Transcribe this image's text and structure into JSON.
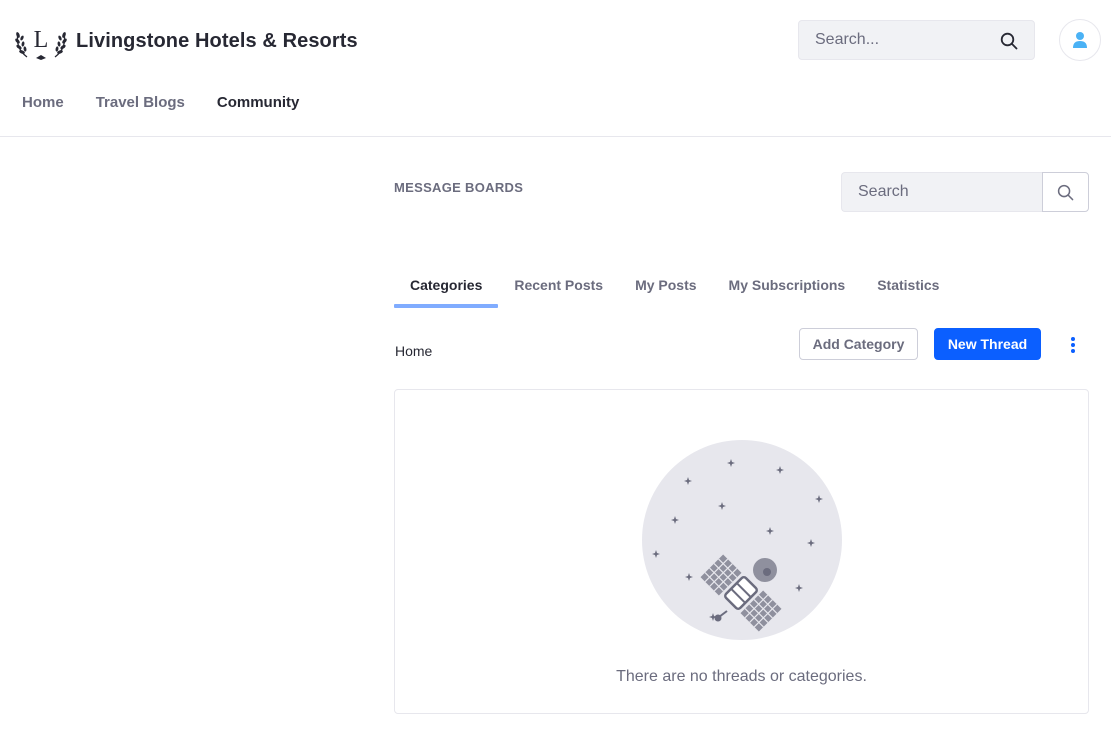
{
  "site": {
    "name": "Livingstone Hotels & Resorts",
    "logo_icon": "laurel-L-logo-icon"
  },
  "header_search": {
    "placeholder": "Search...",
    "icon": "search-icon"
  },
  "user": {
    "icon": "user-avatar-icon"
  },
  "nav": {
    "items": [
      {
        "label": "Home",
        "active": false
      },
      {
        "label": "Travel Blogs",
        "active": false
      },
      {
        "label": "Community",
        "active": true
      }
    ]
  },
  "portlet": {
    "title": "MESSAGE BOARDS",
    "search": {
      "placeholder": "Search",
      "icon": "search-icon"
    },
    "tabs": [
      {
        "label": "Categories",
        "active": true
      },
      {
        "label": "Recent Posts",
        "active": false
      },
      {
        "label": "My Posts",
        "active": false
      },
      {
        "label": "My Subscriptions",
        "active": false
      },
      {
        "label": "Statistics",
        "active": false
      }
    ],
    "breadcrumb": "Home",
    "add_category_label": "Add Category",
    "new_thread_label": "New Thread",
    "options_icon": "vertical-ellipsis-icon",
    "empty_state": {
      "message": "There are no threads or categories.",
      "illustration": "satellite-in-space-illustration"
    }
  },
  "colors": {
    "primary": "#0b5fff",
    "tab_indicator": "#80acff",
    "text_dark": "#272833",
    "text_muted": "#6b6c7e",
    "border": "#e7e7ed",
    "avatar": "#4bb2f5"
  }
}
